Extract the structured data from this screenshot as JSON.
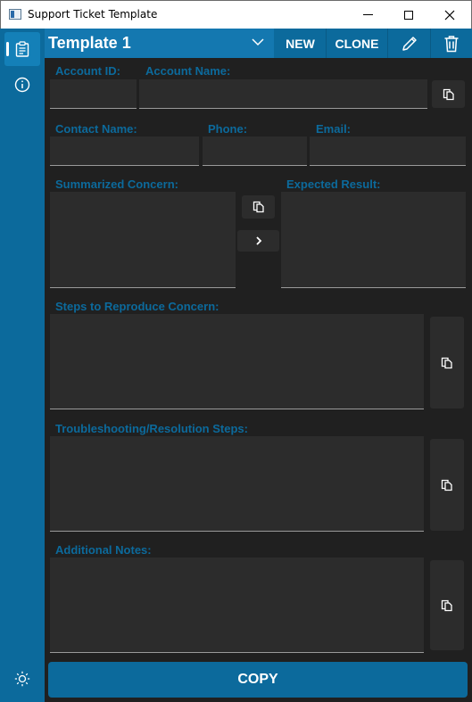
{
  "window": {
    "title": "Support Ticket Template"
  },
  "toolbar": {
    "template_selected": "Template 1",
    "new_label": "NEW",
    "clone_label": "CLONE"
  },
  "form": {
    "account_id_label": "Account ID:",
    "account_id_value": "",
    "account_name_label": "Account Name:",
    "account_name_value": "",
    "contact_name_label": "Contact Name:",
    "contact_name_value": "",
    "phone_label": "Phone:",
    "phone_value": "",
    "email_label": "Email:",
    "email_value": "",
    "summarized_concern_label": "Summarized Concern:",
    "summarized_concern_value": "",
    "expected_result_label": "Expected Result:",
    "expected_result_value": "",
    "steps_label": "Steps to Reproduce Concern:",
    "steps_value": "",
    "troubleshooting_label": "Troubleshooting/Resolution Steps:",
    "troubleshooting_value": "",
    "notes_label": "Additional Notes:",
    "notes_value": ""
  },
  "footer": {
    "copy_label": "COPY"
  },
  "colors": {
    "accent": "#0c6a9c",
    "background": "#202020",
    "field": "#2c2c2c"
  }
}
